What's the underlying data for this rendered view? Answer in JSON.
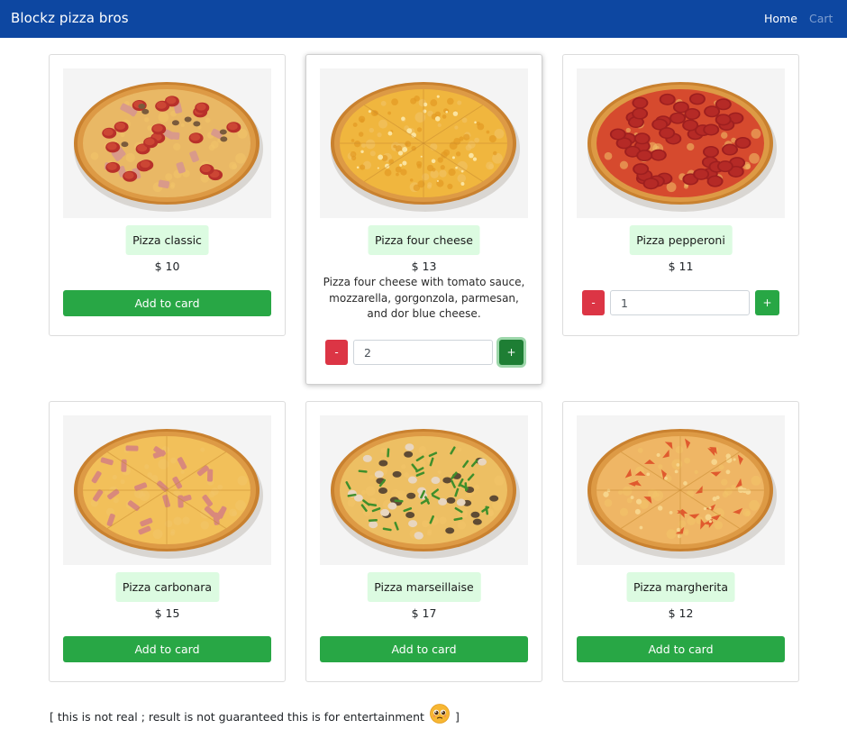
{
  "navbar": {
    "brand": "Blockz pizza bros",
    "links": [
      "Home",
      "Cart"
    ]
  },
  "products": [
    {
      "name": "Pizza classic",
      "price": "$ 10",
      "description": "",
      "action": "Add to card",
      "topping": "pepperoni-ham-mushroom"
    },
    {
      "name": "Pizza four cheese",
      "price": "$ 13",
      "description": "Pizza four cheese with tomato sauce, mozzarella, gorgonzola, parmesan, and dor blue cheese.",
      "quantity": "2",
      "minus_label": "-",
      "plus_label": "+",
      "topping": "cheese"
    },
    {
      "name": "Pizza pepperoni",
      "price": "$ 11",
      "description": "",
      "quantity": "1",
      "minus_label": "-",
      "plus_label": "+",
      "topping": "pepperoni"
    },
    {
      "name": "Pizza carbonara",
      "price": "$ 15",
      "description": "",
      "action": "Add to card",
      "topping": "bacon"
    },
    {
      "name": "Pizza marseillaise",
      "price": "$ 17",
      "description": "",
      "action": "Add to card",
      "topping": "herbs-mushroom"
    },
    {
      "name": "Pizza margherita",
      "price": "$ 12",
      "description": "",
      "action": "Add to card",
      "topping": "tomato"
    }
  ],
  "footer": {
    "note_prefix": "[ this is not real ; result is not guaranteed this is for entertainment",
    "note_suffix": "]",
    "emoji": "pleading-face-icon"
  },
  "colors": {
    "navbar": "#0d47a1",
    "add_button": "#28a745",
    "minus_button": "#dc3545",
    "name_chip": "#dcfbe1"
  }
}
